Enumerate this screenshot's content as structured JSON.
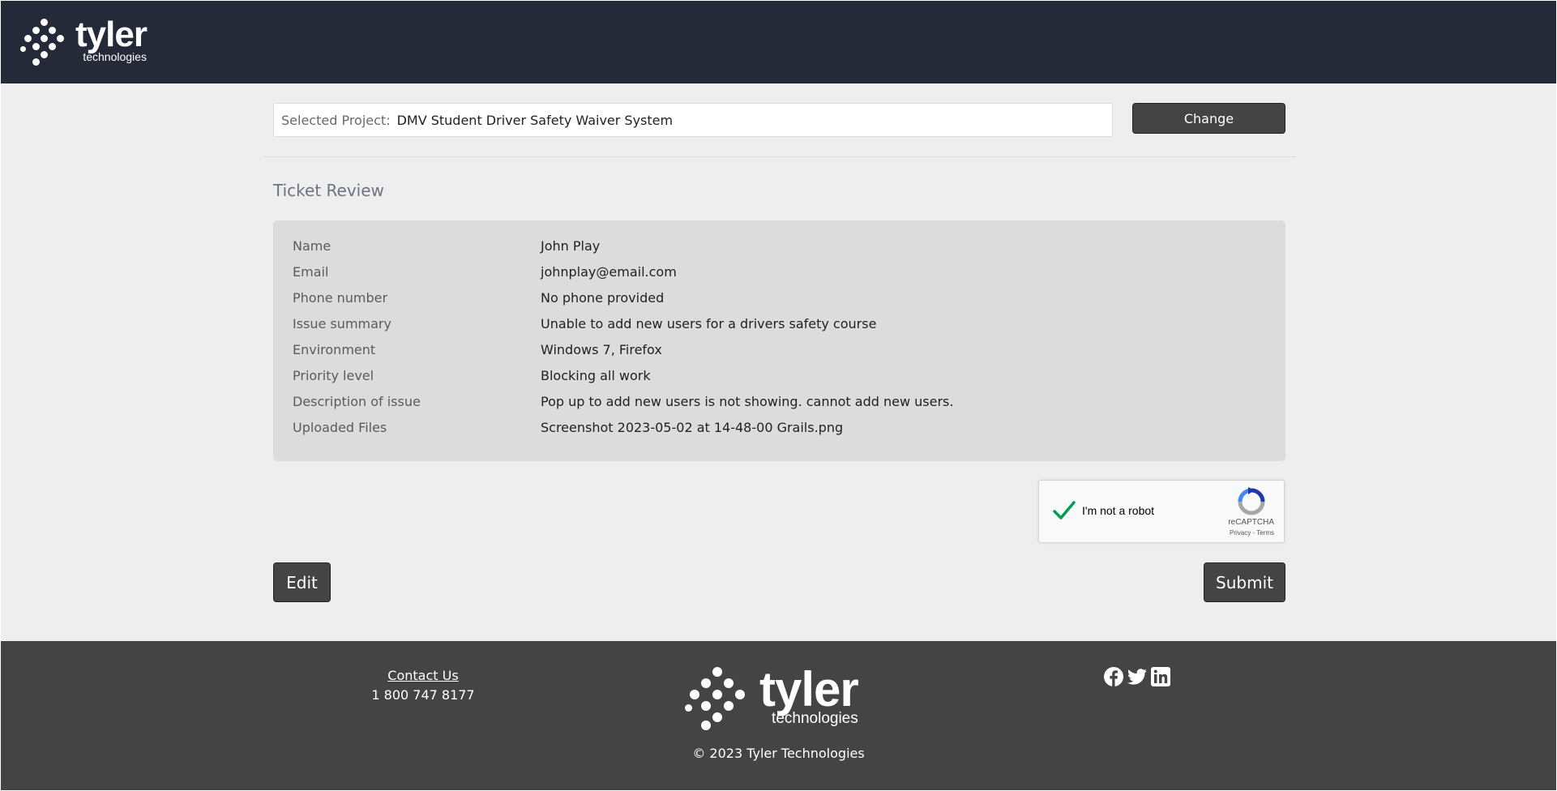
{
  "header": {
    "logo_word": "tyler",
    "logo_sub": "technologies"
  },
  "project": {
    "label": "Selected Project:",
    "value": "DMV Student Driver Safety Waiver System",
    "change_label": "Change"
  },
  "review": {
    "title": "Ticket Review",
    "rows": [
      {
        "label": "Name",
        "value": "John Play"
      },
      {
        "label": "Email",
        "value": "johnplay@email.com"
      },
      {
        "label": "Phone number",
        "value": "No phone provided"
      },
      {
        "label": "Issue summary",
        "value": "Unable to add new users for a drivers safety course"
      },
      {
        "label": "Environment",
        "value": "Windows 7, Firefox"
      },
      {
        "label": "Priority level",
        "value": "Blocking all work"
      },
      {
        "label": "Description of issue",
        "value": "Pop up to add new users is not showing. cannot add new users."
      },
      {
        "label": "Uploaded Files",
        "value": "Screenshot 2023-05-02 at 14-48-00 Grails.png"
      }
    ]
  },
  "captcha": {
    "label": "I'm not a robot",
    "brand": "reCAPTCHA",
    "links": "Privacy - Terms",
    "checked": true,
    "check_color": "#009e55"
  },
  "actions": {
    "edit_label": "Edit",
    "submit_label": "Submit"
  },
  "footer": {
    "contact_label": "Contact Us",
    "phone": "1 800 747 8177",
    "logo_word": "tyler",
    "logo_sub": "technologies",
    "copyright": "© 2023 Tyler Technologies",
    "social_icons": [
      "facebook-icon",
      "twitter-icon",
      "linkedin-icon"
    ]
  },
  "colors": {
    "header_bg": "#242a38",
    "body_bg": "#eeeeee",
    "footer_bg": "#444444",
    "button_bg": "#444444"
  }
}
